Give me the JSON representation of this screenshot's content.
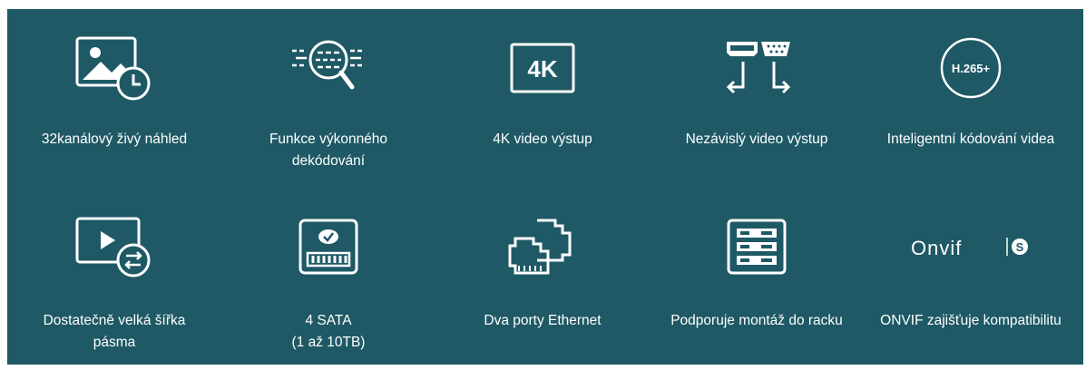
{
  "features": [
    {
      "icon": "image-clock-icon",
      "lines": [
        "32kanálový živý náhled"
      ]
    },
    {
      "icon": "search-decoding-icon",
      "lines": [
        "Funkce výkonného",
        "dekódování"
      ]
    },
    {
      "icon": "4k-badge-icon",
      "badge": "4K",
      "lines": [
        "4K video výstup"
      ]
    },
    {
      "icon": "hdmi-vga-ports-icon",
      "lines": [
        "Nezávislý video výstup"
      ]
    },
    {
      "icon": "h265-badge-icon",
      "badge": "H.265+",
      "lines": [
        "Inteligentní kódování videa"
      ]
    },
    {
      "icon": "video-bandwidth-icon",
      "lines": [
        "Dostatečně velká šířka",
        "pásma"
      ]
    },
    {
      "icon": "hard-drive-icon",
      "lines": [
        "4 SATA",
        "(1 až 10TB)"
      ]
    },
    {
      "icon": "ethernet-ports-icon",
      "lines": [
        "Dva porty Ethernet"
      ]
    },
    {
      "icon": "rack-mount-icon",
      "lines": [
        "Podporuje montáž do racku"
      ]
    },
    {
      "icon": "onvif-logo-icon",
      "badge": "Onvif",
      "badge_s": "S",
      "lines": [
        "ONVIF zajišťuje kompatibilitu"
      ]
    }
  ],
  "colors": {
    "background": "#1e5965",
    "foreground": "#ffffff"
  }
}
